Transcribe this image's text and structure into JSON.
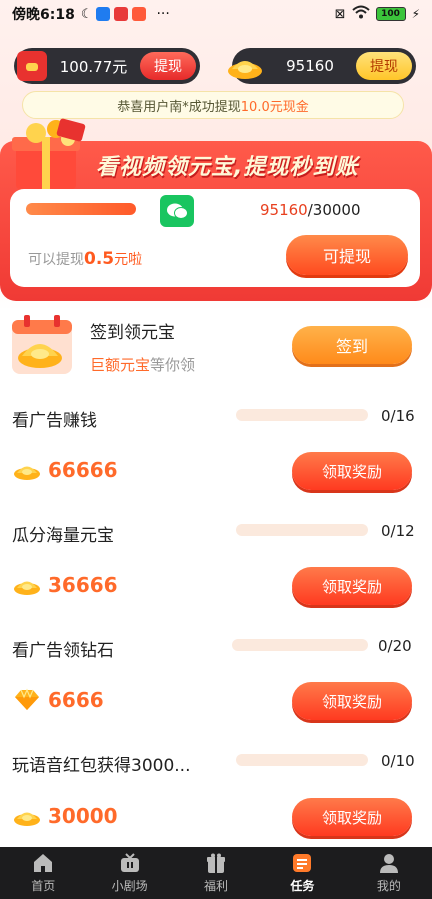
{
  "status_bar": {
    "time": "傍晚6:18",
    "dots": "···",
    "battery": "100"
  },
  "balances": {
    "cash_amount": "100.77元",
    "cash_withdraw": "提现",
    "gold_amount": "95160",
    "gold_withdraw": "提现"
  },
  "notice": {
    "prefix": "恭喜用户南*成功提现",
    "highlight": "10.0元现金"
  },
  "promo": {
    "title": "看视频领元宝,提现秒到账",
    "progress_current": "95160",
    "progress_total": "/30000",
    "can_prefix": "可以提现",
    "can_amount": "0.5",
    "can_suffix": "元啦",
    "can_button": "可提现"
  },
  "checkin": {
    "title": "签到领元宝",
    "sub_highlight": "巨额元宝",
    "sub_rest": "等你领",
    "button": "签到"
  },
  "tasks": [
    {
      "title": "看广告赚钱",
      "count": "0/16",
      "reward": "66666",
      "icon": "gold-ingot-icon",
      "button": "领取奖励"
    },
    {
      "title": "瓜分海量元宝",
      "count": "0/12",
      "reward": "36666",
      "icon": "gold-ingot-icon",
      "button": "领取奖励"
    },
    {
      "title": "看广告领钻石",
      "count": "0/20",
      "reward": "6666",
      "icon": "diamond-icon",
      "button": "领取奖励"
    },
    {
      "title": "玩语音红包获得3000...",
      "count": "0/10",
      "reward": "30000",
      "icon": "gold-ingot-icon",
      "button": "领取奖励"
    }
  ],
  "nav": [
    {
      "label": "首页",
      "icon": "home-icon"
    },
    {
      "label": "小剧场",
      "icon": "tv-icon"
    },
    {
      "label": "福利",
      "icon": "gift-icon"
    },
    {
      "label": "任务",
      "icon": "tasks-icon",
      "active": true
    },
    {
      "label": "我的",
      "icon": "person-icon"
    }
  ],
  "colors": {
    "accent": "#ff5a2a",
    "promo_red": "#f03a35",
    "nav_bg": "#1c1c1e"
  }
}
